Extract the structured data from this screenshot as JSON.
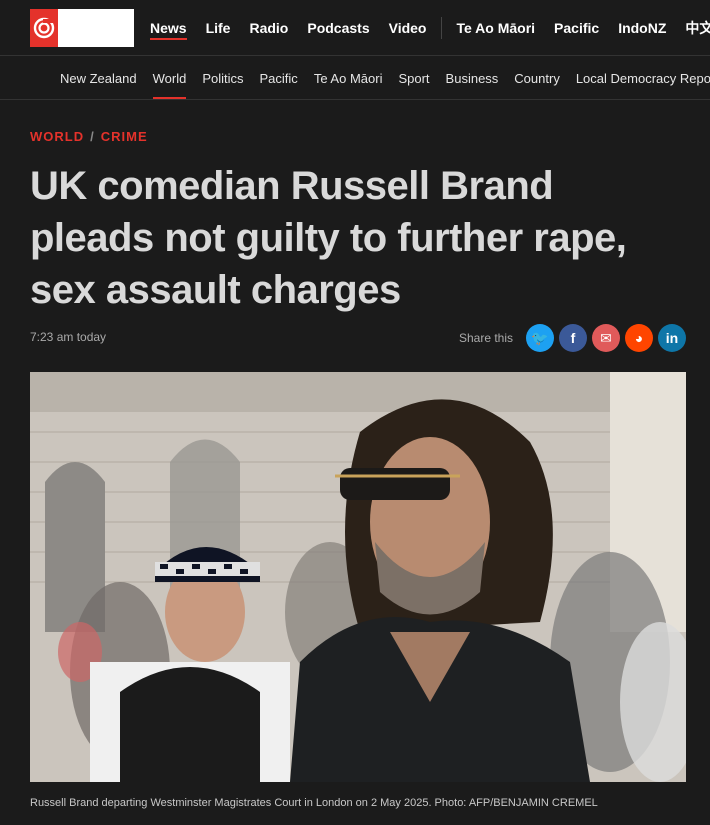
{
  "topnav": {
    "items": [
      {
        "label": "News",
        "active": true
      },
      {
        "label": "Life"
      },
      {
        "label": "Radio"
      },
      {
        "label": "Podcasts"
      },
      {
        "label": "Video"
      }
    ],
    "items_right": [
      {
        "label": "Te Ao Māori"
      },
      {
        "label": "Pacific"
      },
      {
        "label": "IndoNZ"
      },
      {
        "label": "中文"
      }
    ]
  },
  "subnav": {
    "items": [
      {
        "label": "New Zealand"
      },
      {
        "label": "World",
        "active": true
      },
      {
        "label": "Politics"
      },
      {
        "label": "Pacific"
      },
      {
        "label": "Te Ao Māori"
      },
      {
        "label": "Sport"
      },
      {
        "label": "Business"
      },
      {
        "label": "Country"
      },
      {
        "label": "Local Democracy Reporting"
      }
    ]
  },
  "article": {
    "section": "WORLD",
    "category": "CRIME",
    "separator": "/",
    "headline": "UK comedian Russell Brand pleads not guilty to further rape, sex assault charges",
    "timestamp": "7:23 am today",
    "share_label": "Share this",
    "caption": "Russell Brand departing Westminster Magistrates Court in London on 2 May 2025. Photo: AFP/BENJAMIN CREMEL"
  },
  "share_buttons": [
    {
      "icon": "twitter-icon",
      "glyph": "🐦",
      "color": "#1da1f2"
    },
    {
      "icon": "facebook-icon",
      "glyph": "f",
      "color": "#3b5998"
    },
    {
      "icon": "email-icon",
      "glyph": "✉",
      "color": "#e05a5a"
    },
    {
      "icon": "reddit-icon",
      "glyph": "◕",
      "color": "#ff4500"
    },
    {
      "icon": "linkedin-icon",
      "glyph": "in",
      "color": "#0e76a8"
    }
  ],
  "colors": {
    "accent": "#e4322b",
    "background": "#1b1b1b"
  }
}
